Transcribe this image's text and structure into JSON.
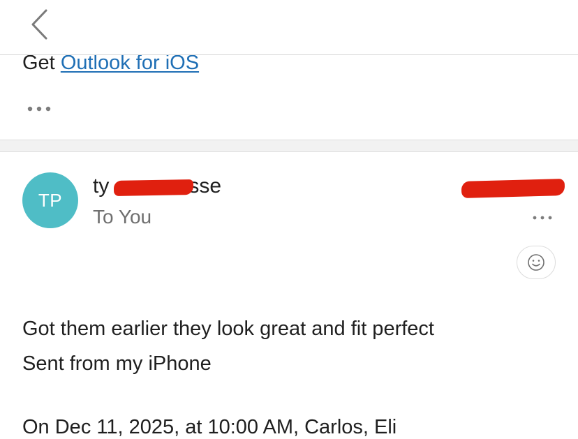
{
  "header": {
    "back_icon": "chevron-left-icon"
  },
  "previous_message": {
    "prefix_text": "Get ",
    "link_text": "Outlook for iOS",
    "more_icon": "ellipsis-icon"
  },
  "message": {
    "avatar_initials": "TP",
    "avatar_color": "#4fbdc6",
    "sender_name_prefix": "ty",
    "sender_name_suffix": "sse",
    "recipient_text": "To You",
    "more_icon": "ellipsis-icon",
    "reaction_icon": "smiley-face-icon",
    "body_lines": [
      "Got them earlier they look great and fit perfect",
      "Sent from my iPhone"
    ],
    "quoted_header": "On Dec 11, 2025, at 10:00 AM, Carlos, Eli"
  },
  "colors": {
    "link": "#1f6fb5",
    "redaction": "#e0200f",
    "secondary_text": "#6f6f6f"
  }
}
